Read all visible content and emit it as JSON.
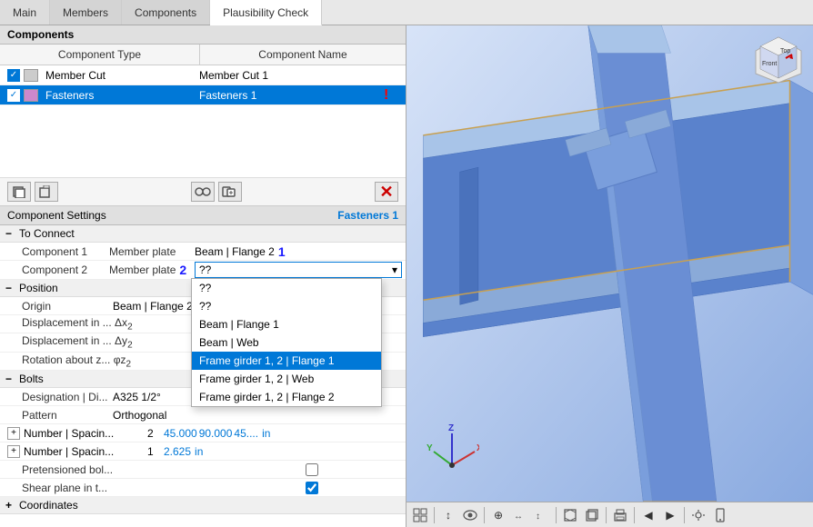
{
  "tabs": [
    {
      "label": "Main",
      "active": false
    },
    {
      "label": "Members",
      "active": false
    },
    {
      "label": "Components",
      "active": false
    },
    {
      "label": "Plausibility Check",
      "active": true
    }
  ],
  "components_section": {
    "title": "Components",
    "col1": "Component Type",
    "col2": "Component Name",
    "rows": [
      {
        "checked": true,
        "color": "#cccccc",
        "type": "Member Cut",
        "name": "Member Cut 1",
        "selected": false,
        "warn": false
      },
      {
        "checked": true,
        "color": "#cc88cc",
        "type": "Fasteners",
        "name": "Fasteners 1",
        "selected": true,
        "warn": true
      }
    ]
  },
  "toolbar_buttons": [
    "copy",
    "paste",
    "assign",
    "clone"
  ],
  "settings": {
    "title": "Component Settings",
    "subtitle": "Fasteners 1",
    "sections": [
      {
        "name": "To Connect",
        "rows": [
          {
            "label": "Component 1",
            "label2": "Member plate",
            "value": "Beam | Flange 2",
            "badge": "1"
          },
          {
            "label": "Component 2",
            "label2": "Member plate",
            "value": "??",
            "badge": "2",
            "dropdown": true
          }
        ]
      },
      {
        "name": "Position",
        "rows": [
          {
            "label": "Origin",
            "value": "Beam | Flange 2"
          },
          {
            "label": "Displacement in ...  Δx2",
            "value": ""
          },
          {
            "label": "Displacement in ...  Δy2",
            "value": ""
          },
          {
            "label": "Rotation about z...  φz2",
            "value": ""
          }
        ]
      },
      {
        "name": "Bolts",
        "rows": [
          {
            "label": "Designation | Di...",
            "value": "A325  1/2°"
          },
          {
            "label": "Pattern",
            "value": "Orthogonal"
          },
          {
            "label": "Number | Spacin...",
            "expandable": true,
            "num": "2",
            "vals": [
              "45.000",
              "90.000",
              "45...."
            ],
            "unit": "in"
          },
          {
            "label": "Number | Spacin...",
            "expandable": true,
            "num": "1",
            "vals": [
              "2.625"
            ],
            "unit": "in"
          },
          {
            "label": "Pretensioned bol...",
            "checkbox": true,
            "checked": false
          },
          {
            "label": "Shear plane in t...",
            "checkbox": true,
            "checked": true
          }
        ]
      },
      {
        "name": "Coordinates",
        "collapsed": true
      }
    ]
  },
  "dropdown_items": [
    {
      "label": "??",
      "selected": false
    },
    {
      "label": "??",
      "selected": false
    },
    {
      "label": "Beam | Flange 1",
      "selected": false
    },
    {
      "label": "Beam | Web",
      "selected": false
    },
    {
      "label": "Frame girder 1, 2 | Flange 1",
      "selected": true
    },
    {
      "label": "Frame girder 1, 2 | Web",
      "selected": false
    },
    {
      "label": "Frame girder 1, 2 | Flange 2",
      "selected": false
    }
  ],
  "view_toolbar": {
    "buttons": [
      "⊞",
      "↑",
      "👁",
      "⊕",
      "↔",
      "↕",
      "□",
      "⬜",
      "🖨",
      "◀",
      "▶"
    ]
  }
}
